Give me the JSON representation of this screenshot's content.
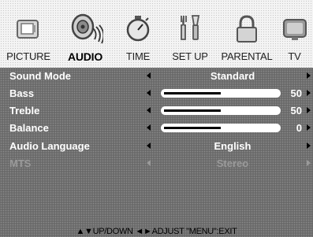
{
  "tabs": [
    {
      "label": "PICTURE",
      "icon": "picture-icon",
      "active": false
    },
    {
      "label": "AUDIO",
      "icon": "speaker-icon",
      "active": true
    },
    {
      "label": "TIME",
      "icon": "stopwatch-icon",
      "active": false
    },
    {
      "label": "SET UP",
      "icon": "tools-icon",
      "active": false
    },
    {
      "label": "PARENTAL",
      "icon": "lock-icon",
      "active": false
    },
    {
      "label": "TV",
      "icon": "tv-icon",
      "active": false
    }
  ],
  "menu": {
    "sound_mode": {
      "label": "Sound Mode",
      "value": "Standard"
    },
    "bass": {
      "label": "Bass",
      "value": "50",
      "level": 0.5
    },
    "treble": {
      "label": "Treble",
      "value": "50",
      "level": 0.5
    },
    "balance": {
      "label": "Balance",
      "value": "0",
      "level": 0.5
    },
    "audio_language": {
      "label": "Audio Language",
      "value": "English"
    },
    "mts": {
      "label": "MTS",
      "value": "Stereo",
      "disabled": true
    }
  },
  "footer": {
    "hint": "▲▼UP/DOWN ◄►ADJUST \"MENU\":EXIT"
  },
  "colors": {
    "menu_bg": "#6a6a6a",
    "text": "#ffffff",
    "disabled": "#9a9a9a"
  }
}
